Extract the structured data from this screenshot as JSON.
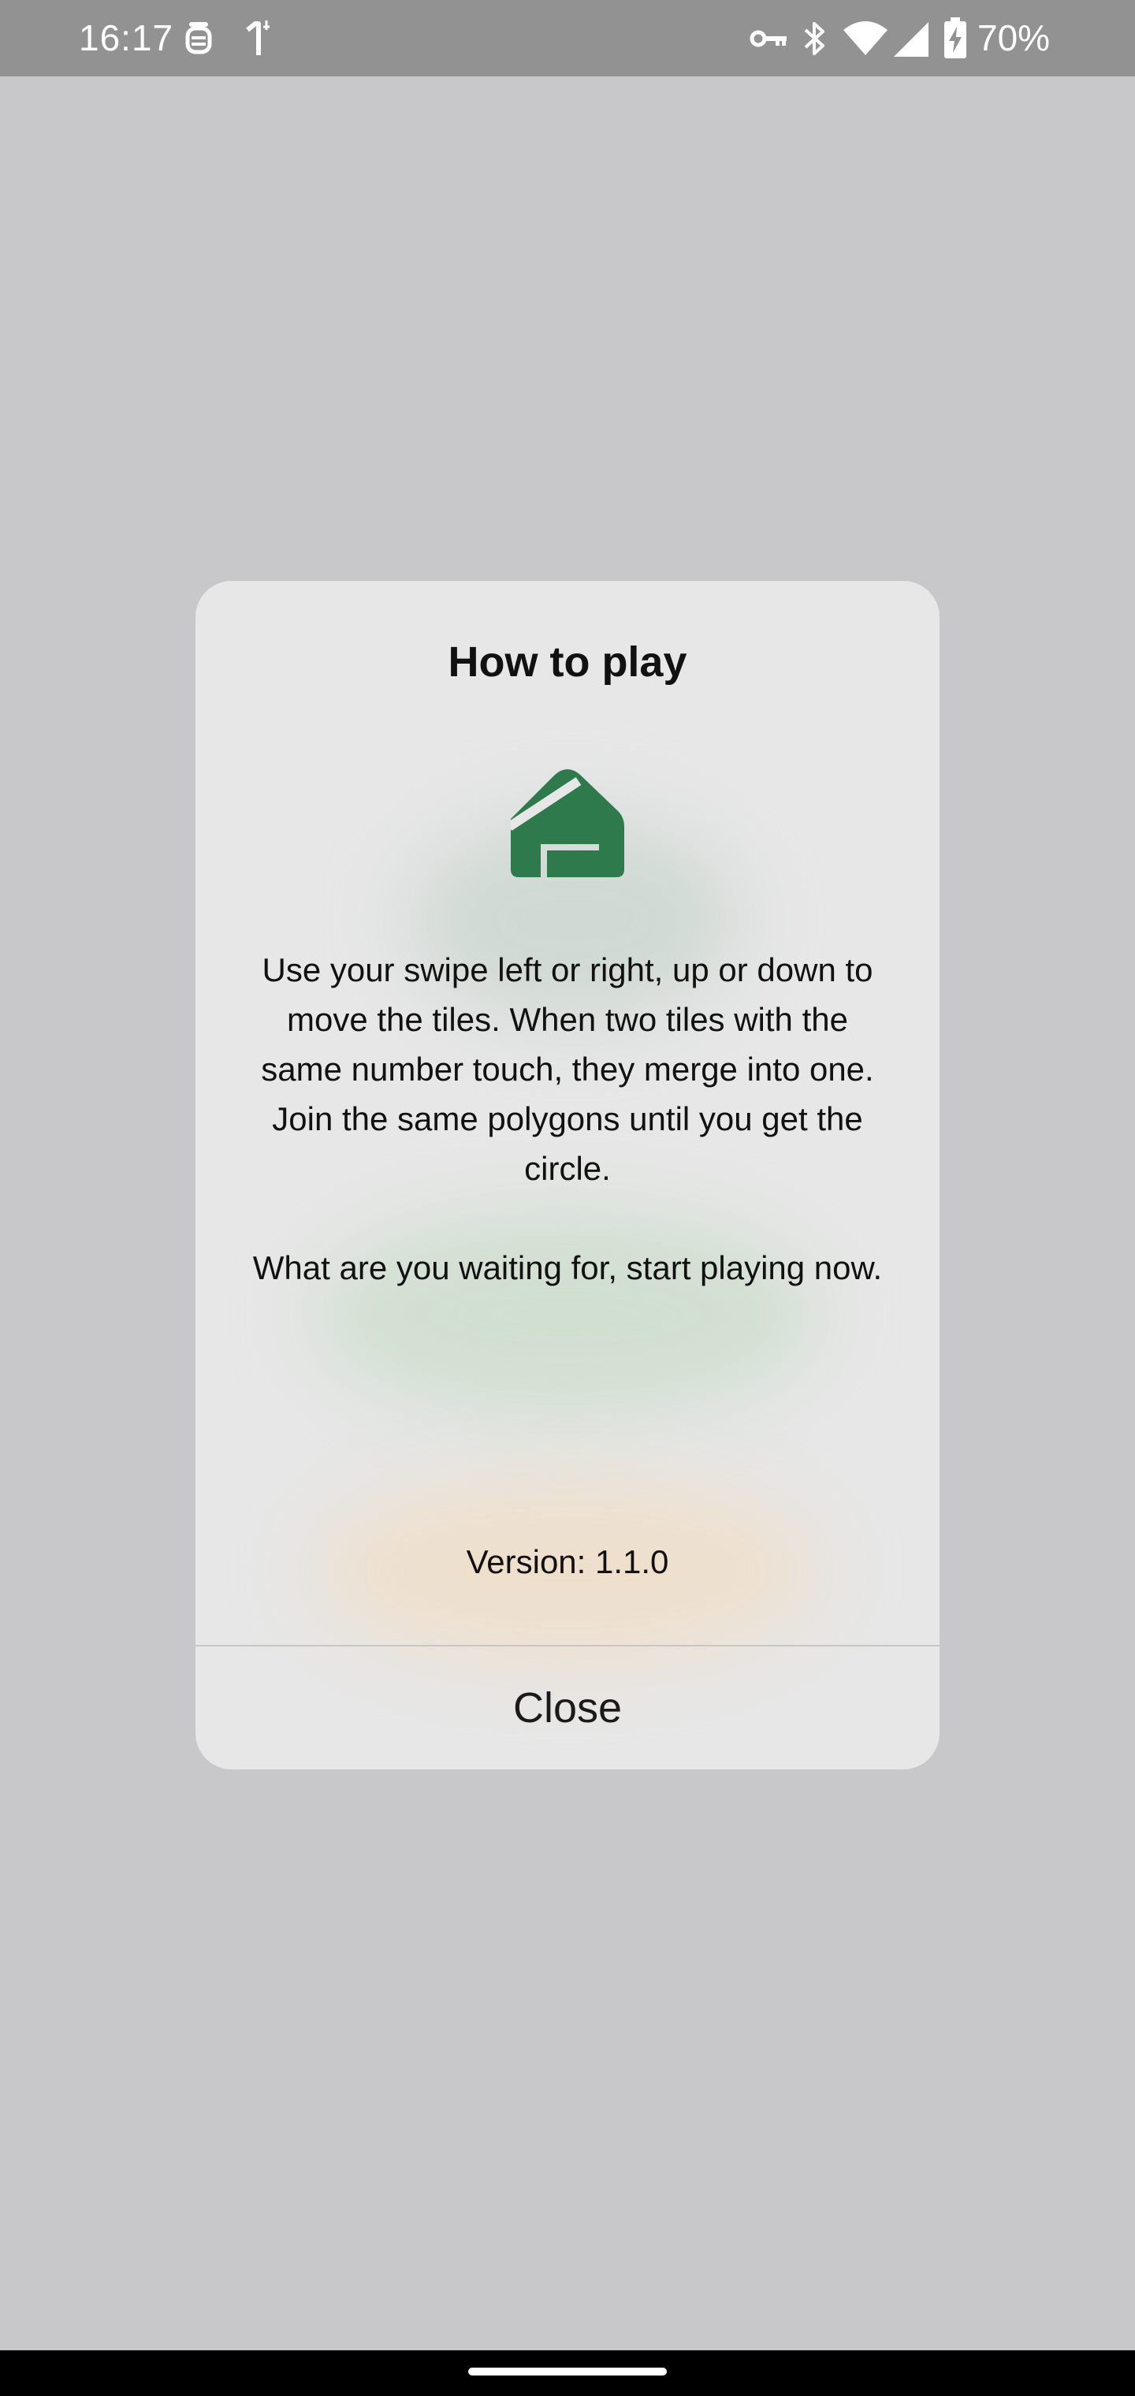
{
  "status_bar": {
    "time": "16:17",
    "battery_text": "70%",
    "icons": [
      "alarm-icon",
      "notification-one-icon",
      "vpn-key-icon",
      "bluetooth-icon",
      "wifi-icon",
      "cellular-signal-icon",
      "battery-charging-icon"
    ]
  },
  "dialog": {
    "title": "How to play",
    "logo_icon": "house-polygon-logo",
    "body": "Use your swipe left or right, up or down to move the tiles. When two tiles with the same number touch, they merge into one.\nJoin the same polygons until you get the circle.\n\nWhat are you waiting for, start playing now.",
    "version": "Version: 1.1.0",
    "close_label": "Close"
  },
  "colors": {
    "accent_green": "#2f7a4c",
    "backdrop": "#c8c7c9",
    "dialog_bg": "#e7e7e7"
  }
}
